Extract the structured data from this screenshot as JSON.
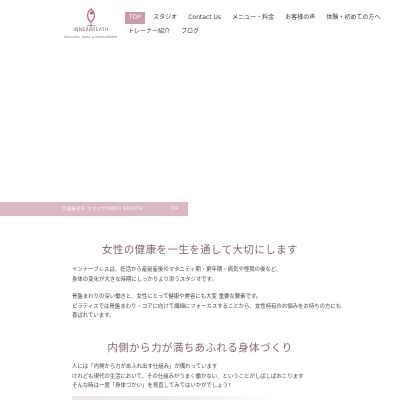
{
  "logo": {
    "name": "INNERBREATH",
    "tagline": "RELAXING · BODY & DEVELOPMENT",
    "icon": "lotus-figure-logo"
  },
  "nav": {
    "row1": [
      "TOP",
      "スタジオ",
      "Contact Us",
      "メニュー・料金",
      "お客様の声",
      "体験・初めての方へ"
    ],
    "row2": [
      "トレーナー紹介",
      "ブログ"
    ],
    "active": "TOP",
    "accent": "#c99aa9"
  },
  "breadcrumb": {
    "text": "大阪藤井寺 スタジオINNER BREATH",
    "top": "TOP"
  },
  "section1": {
    "heading": "女性の健康を一生を通して大切にします",
    "lines": [
      "インナーブレスは、妊活から産前産後のマタニティ期・更年期・病気や怪我の後など、",
      "身体の変化が大きな時期にしっかりより添うスタジオです。"
    ],
    "lines2": [
      "骨盤まわりの深い働きと、女性にとって健康や美容にも大変 重要な要素です。",
      "ピラティスでは骨盤まわり・コアに向けて繊細にフォーカスすることから、女性特有のお悩みをお持ちの方にも",
      "喜ばれています。"
    ]
  },
  "section2": {
    "heading": "内側から力が満ちあふれる身体づくり",
    "lines": [
      "人には「内側から力があふれ出す仕組み」が備わっています",
      "けれども現代の生活において、その仕組みがうまく働かない、ということがしばしばおこります",
      "そんな時は一度「身体づかい」を見直してみてはいかがでしょう?"
    ]
  },
  "colors": {
    "heading": "#7e6671",
    "crumb_bg": "#d9b8c4"
  }
}
